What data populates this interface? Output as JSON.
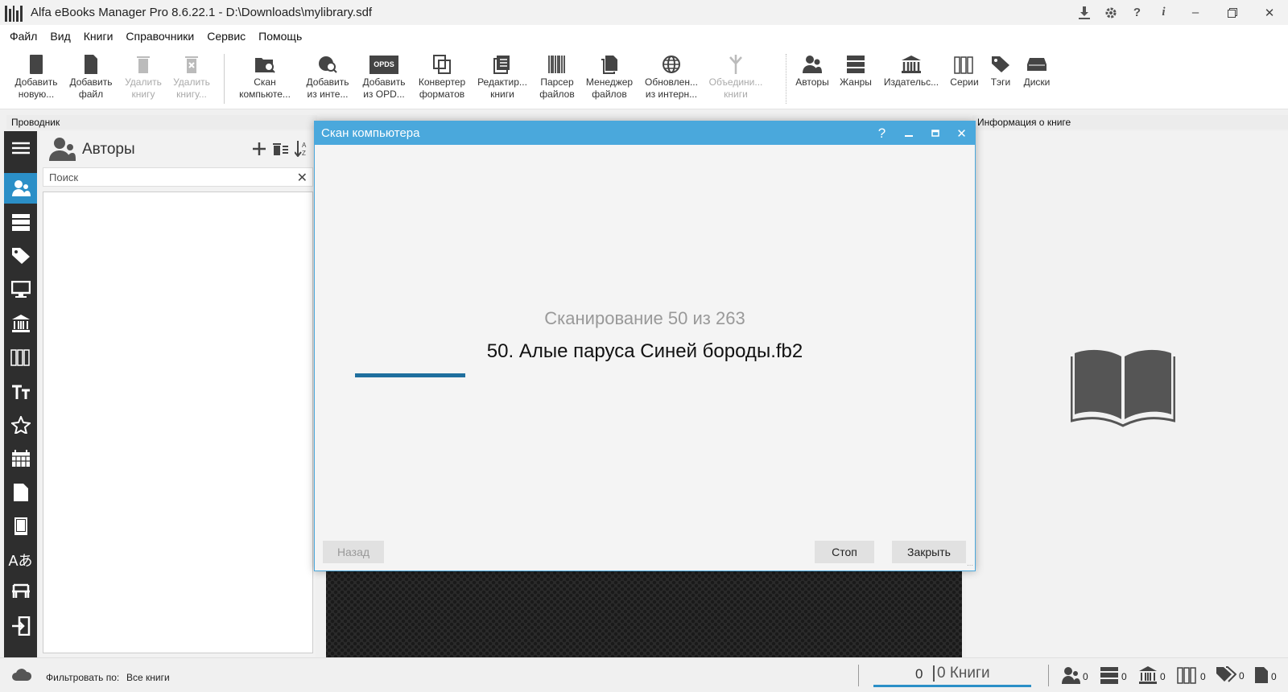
{
  "window": {
    "title": "Alfa eBooks Manager Pro 8.6.22.1 - D:\\Downloads\\mylibrary.sdf"
  },
  "menu": [
    "Файл",
    "Вид",
    "Книги",
    "Справочники",
    "Сервис",
    "Помощь"
  ],
  "toolbar": {
    "add_new": [
      "Добавить",
      "новую..."
    ],
    "add_file": [
      "Добавить",
      "файл"
    ],
    "delete_book": [
      "Удалить",
      "книгу"
    ],
    "delete_book2": [
      "Удалить",
      "книгу..."
    ],
    "scan_computer": [
      "Скан",
      "компьюте..."
    ],
    "add_internet": [
      "Добавить",
      "из инте..."
    ],
    "add_opds": [
      "Добавить",
      "из OPD..."
    ],
    "opds_badge": "OPDS",
    "converter": [
      "Конвертер",
      "форматов"
    ],
    "editor": [
      "Редактир...",
      "книги"
    ],
    "parser": [
      "Парсер",
      "файлов"
    ],
    "file_manager": [
      "Менеджер",
      "файлов"
    ],
    "update_internet": [
      "Обновлен...",
      "из интерн..."
    ],
    "merge": [
      "Объедини...",
      "книги"
    ],
    "authors": "Авторы",
    "genres": "Жанры",
    "publishers": "Издательс...",
    "series": "Серии",
    "tags": "Тэги",
    "disks": "Диски"
  },
  "panels": {
    "explorer_header": "Проводник",
    "info_header": "Информация о книге"
  },
  "authors_panel": {
    "title": "Авторы",
    "search_placeholder": "Поиск"
  },
  "dialog": {
    "title": "Скан компьютера",
    "status": "Сканирование 50 из 263",
    "current_file": "50. Алые паруса Синей бороды.fb2",
    "back_button": "Назад",
    "stop_button": "Стоп",
    "close_button": "Закрыть",
    "progress_fraction": 0.19
  },
  "statusbar": {
    "filter_label": "Фильтровать по:",
    "filter_value": "Все книги",
    "count": "0",
    "books_label": "0 Книги",
    "authors_count": "0",
    "genres_count": "0",
    "publishers_count": "0",
    "series_count": "0",
    "tags_count": "0",
    "files_count": "0"
  },
  "colors": {
    "accent": "#4aa8dc",
    "nav_active": "#2b8fc7",
    "nav_bg": "#2e2e2e",
    "progress": "#1f6f9e"
  }
}
